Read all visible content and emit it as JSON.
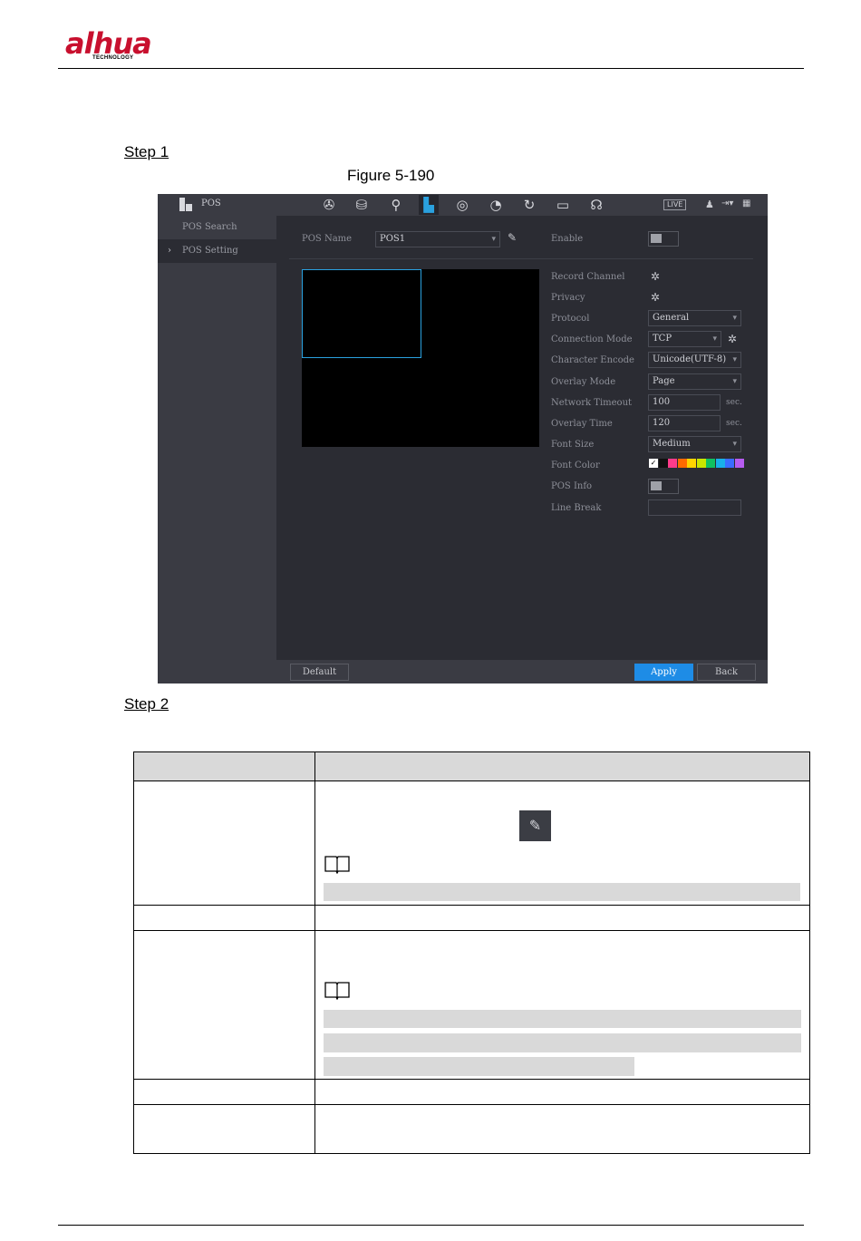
{
  "header": {
    "brand": "alhua",
    "brand_sub": "TECHNOLOGY"
  },
  "steps": {
    "step1": "Step 1",
    "figure": "Figure 5-190",
    "step2": "Step 2"
  },
  "ui": {
    "title": "POS",
    "live": "LIVE",
    "nav_icons": [
      "camera-icon",
      "storage-icon",
      "search-icon",
      "pos-icon",
      "network-icon",
      "speed-icon",
      "sync-icon",
      "monitor-icon",
      "headset-icon"
    ],
    "sidebar": [
      {
        "label": "POS Search"
      },
      {
        "label": "POS Setting"
      }
    ],
    "pos_name_label": "POS Name",
    "pos_name_value": "POS1",
    "enable_label": "Enable",
    "settings": {
      "record_channel": "Record Channel",
      "privacy": "Privacy",
      "protocol": "Protocol",
      "protocol_value": "General",
      "connection_mode": "Connection Mode",
      "connection_mode_value": "TCP",
      "character_encode": "Character Encode",
      "character_encode_value": "Unicode(UTF-8)",
      "overlay_mode": "Overlay Mode",
      "overlay_mode_value": "Page",
      "network_timeout": "Network Timeout",
      "network_timeout_value": "100",
      "overlay_time": "Overlay Time",
      "overlay_time_value": "120",
      "unit": "sec.",
      "font_size": "Font Size",
      "font_size_value": "Medium",
      "font_color": "Font Color",
      "pos_info": "POS Info",
      "line_break": "Line Break"
    },
    "font_colors": [
      "#ffffff",
      "#111111",
      "#ff3b8b",
      "#ff6a00",
      "#ffd400",
      "#c8e600",
      "#10c060",
      "#18b0e8",
      "#3a6cff",
      "#b65cf0"
    ],
    "buttons": {
      "default": "Default",
      "apply": "Apply",
      "back": "Back"
    }
  }
}
